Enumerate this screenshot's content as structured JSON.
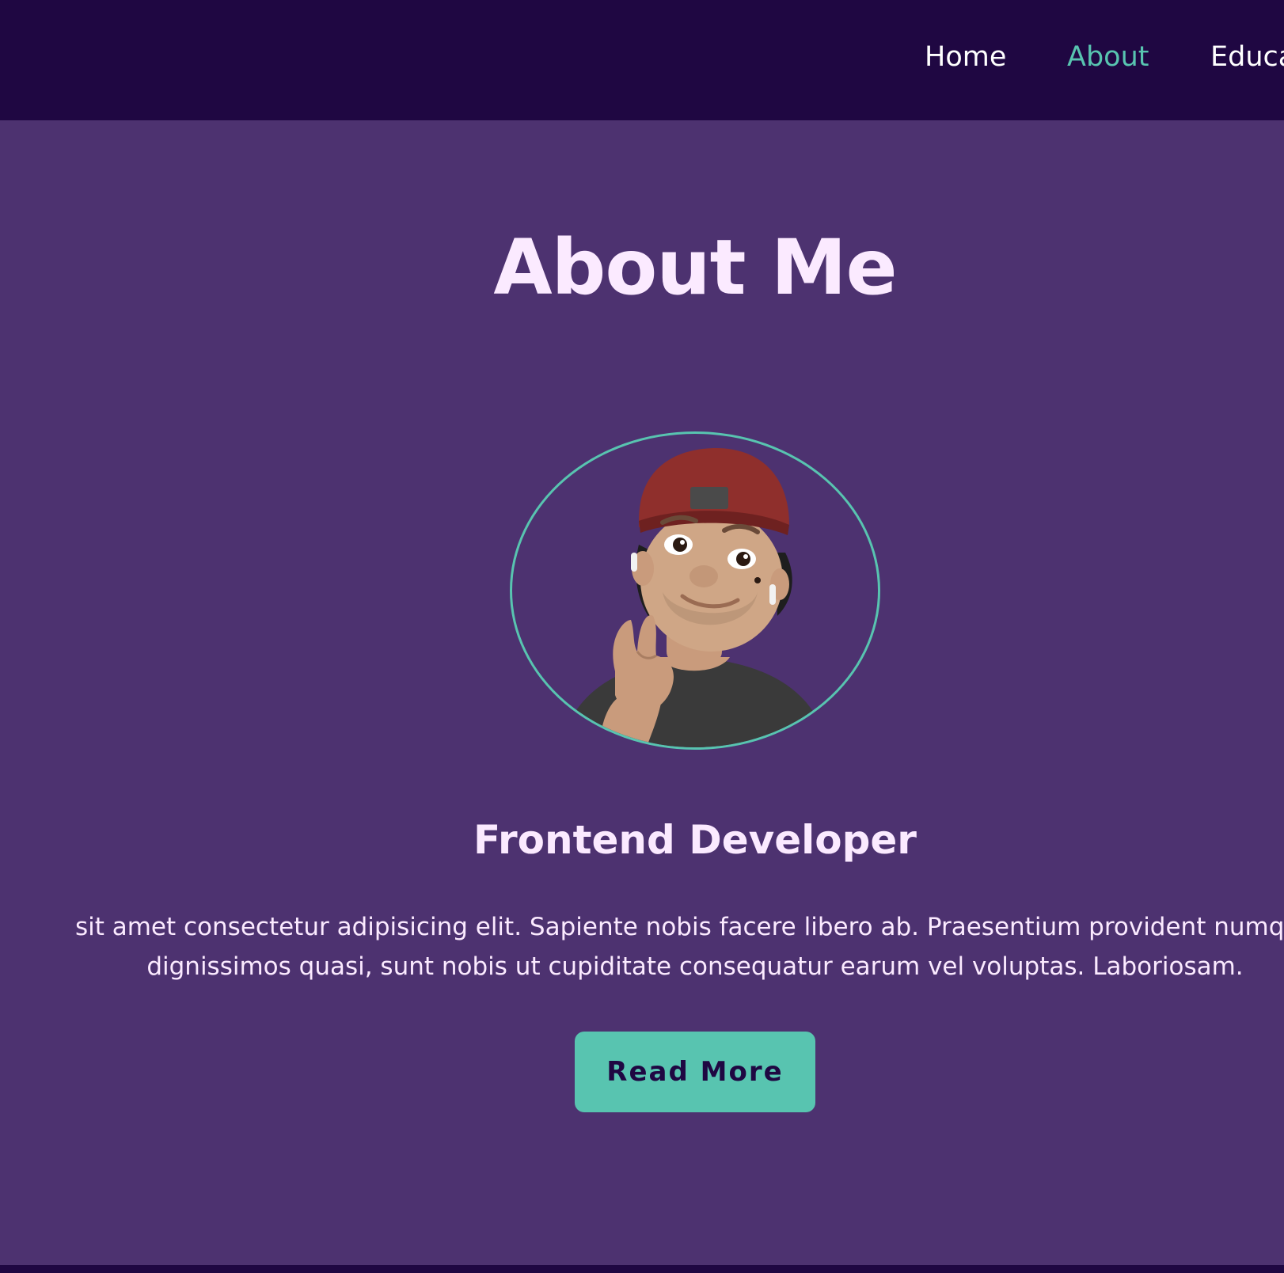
{
  "nav": {
    "items": [
      {
        "label": "Home",
        "active": false
      },
      {
        "label": "About",
        "active": true
      },
      {
        "label": "Educa",
        "active": false
      }
    ]
  },
  "about": {
    "title": "About Me",
    "avatar_icon": "memoji-avatar",
    "role": "Frontend Developer",
    "description_line1": "sit amet consectetur adipisicing elit. Sapiente nobis facere libero ab. Praesentium provident numqua",
    "description_line2": "dignissimos quasi, sunt nobis ut cupiditate consequatur earum vel voluptas. Laboriosam.",
    "button_label": "Read More"
  },
  "colors": {
    "header_bg": "#1f0742",
    "section_bg": "#4d3270",
    "accent": "#58c4b0",
    "text": "#fbeaff"
  }
}
